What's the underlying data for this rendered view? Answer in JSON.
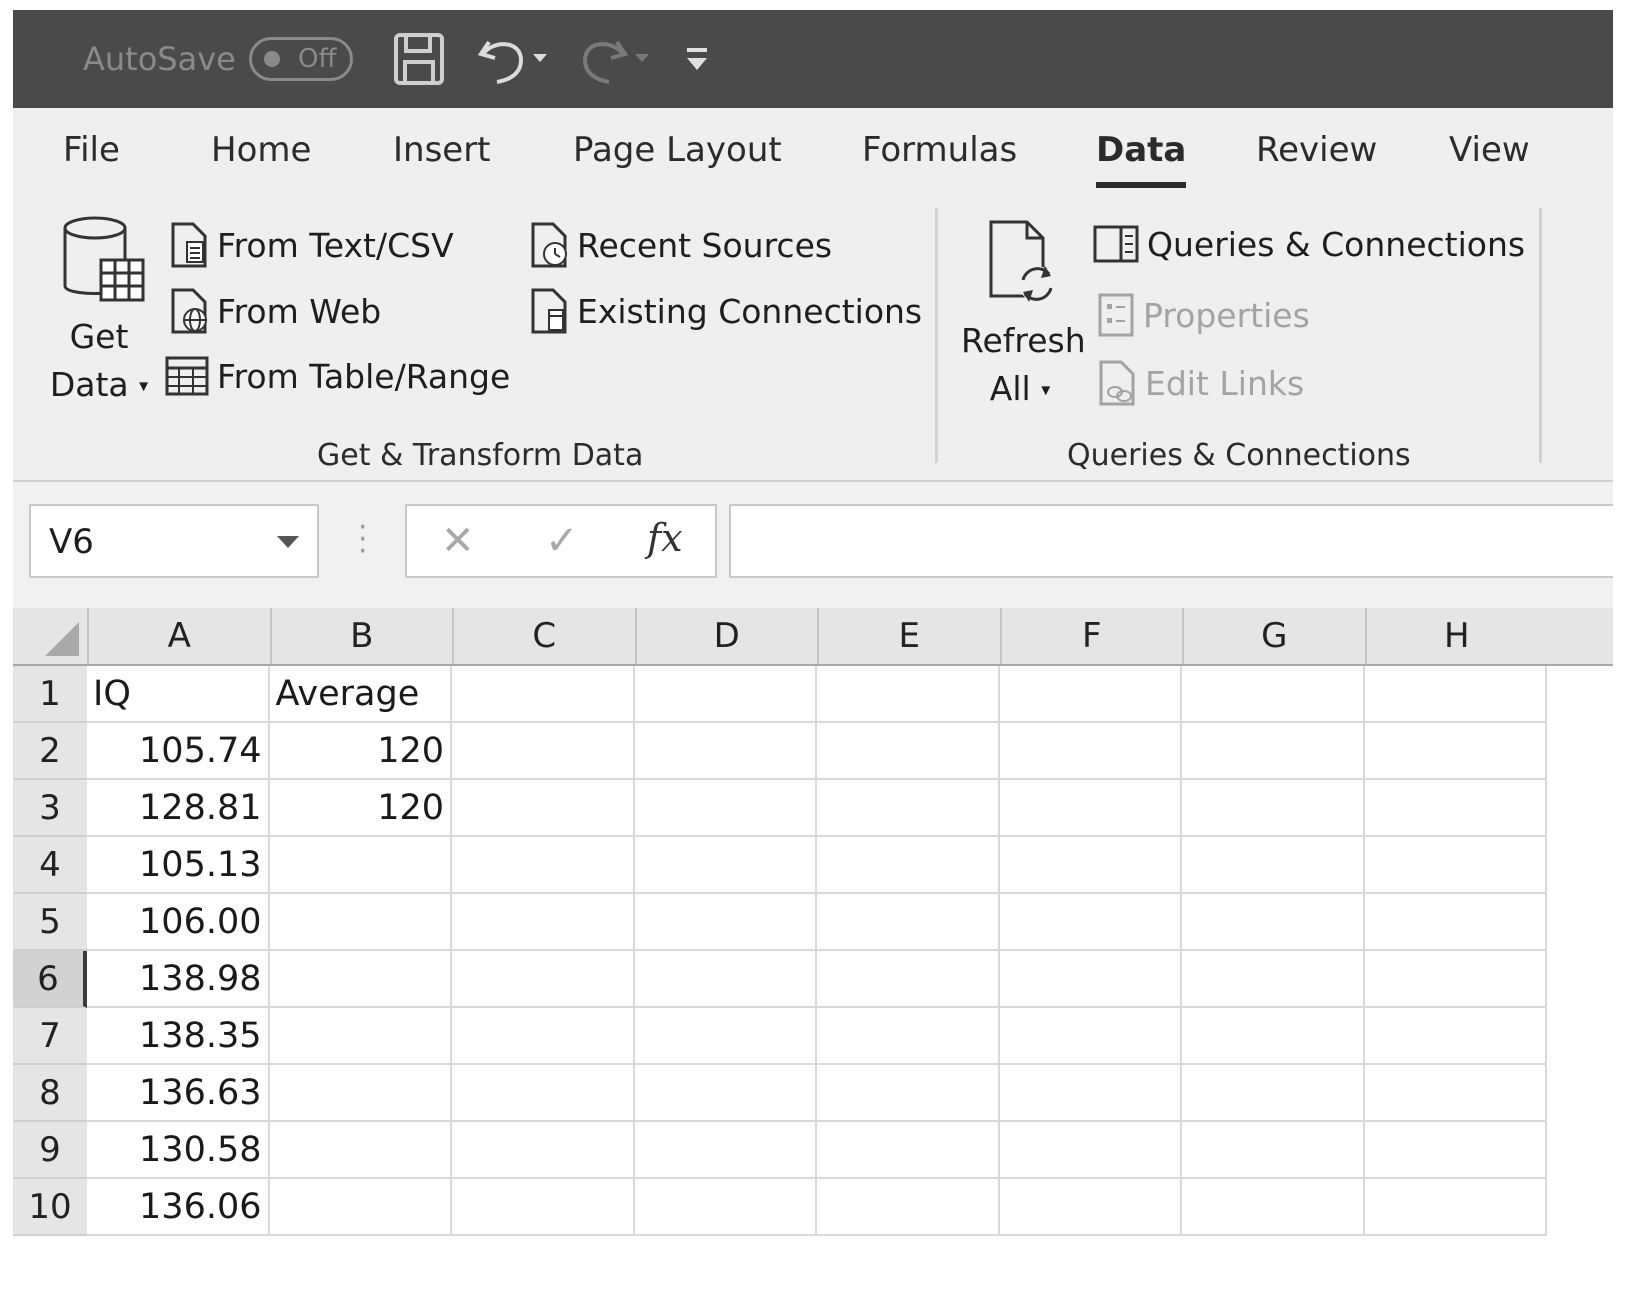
{
  "titlebar": {
    "autosave_label": "AutoSave",
    "autosave_state": "Off"
  },
  "ribbon": {
    "tabs": [
      "File",
      "Home",
      "Insert",
      "Page Layout",
      "Formulas",
      "Data",
      "Review",
      "View"
    ],
    "active_tab": "Data",
    "get_transform": {
      "get_data_line1": "Get",
      "get_data_line2": "Data",
      "from_text_csv": "From Text/CSV",
      "from_web": "From Web",
      "from_table_range": "From Table/Range",
      "recent_sources": "Recent Sources",
      "existing_connections": "Existing Connections",
      "group_label": "Get & Transform Data"
    },
    "queries": {
      "refresh_line1": "Refresh",
      "refresh_line2": "All",
      "queries_connections": "Queries & Connections",
      "properties": "Properties",
      "edit_links": "Edit Links",
      "group_label": "Queries & Connections"
    }
  },
  "formula_bar": {
    "name_box": "V6",
    "cancel_glyph": "✕",
    "enter_glyph": "✓",
    "fx_label": "fx",
    "formula": ""
  },
  "sheet": {
    "columns": [
      "A",
      "B",
      "C",
      "D",
      "E",
      "F",
      "G",
      "H"
    ],
    "rows": [
      "1",
      "2",
      "3",
      "4",
      "5",
      "6",
      "7",
      "8",
      "9",
      "10"
    ],
    "selected_row": "6",
    "cells": {
      "A1": "IQ",
      "B1": "Average",
      "A2": "105.74",
      "B2": "120",
      "A3": "128.81",
      "B3": "120",
      "A4": "105.13",
      "A5": "106.00",
      "A6": "138.98",
      "A7": "138.35",
      "A8": "136.63",
      "A9": "130.58",
      "A10": "136.06"
    }
  }
}
